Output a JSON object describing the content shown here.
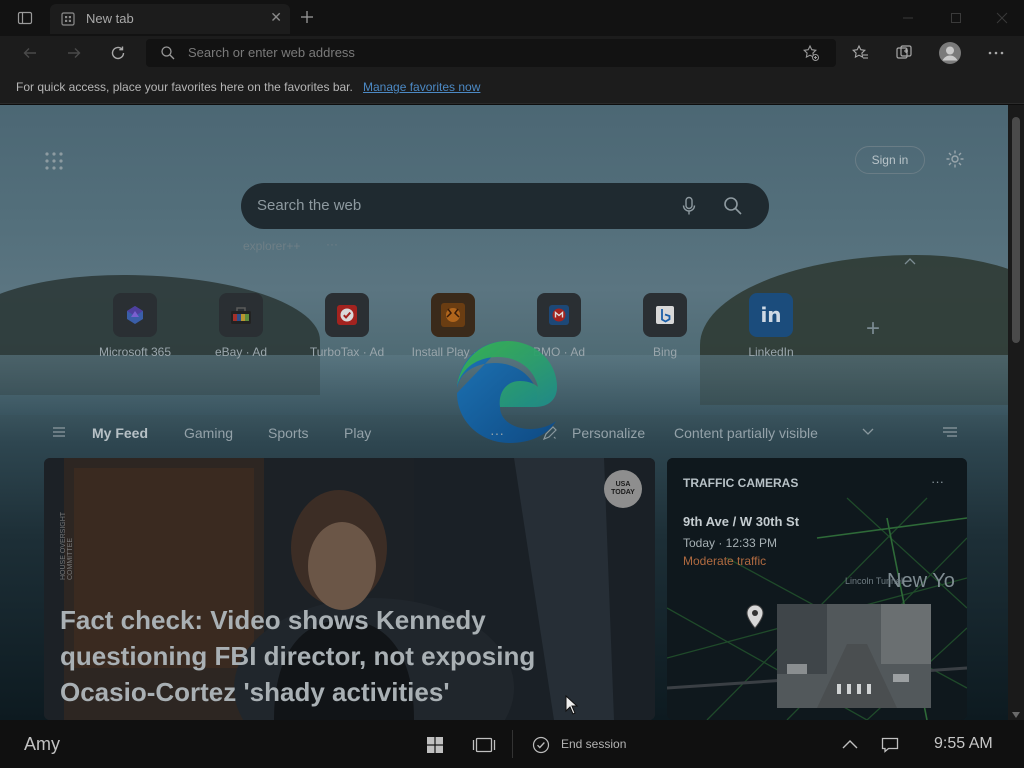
{
  "tabbar": {
    "tab_title": "New tab",
    "close_glyph": "✕",
    "new_tab_glyph": "+",
    "icons": [
      "tab-actions-icon",
      "newtab-page-icon",
      "close-icon",
      "plus-icon",
      "minimize-icon",
      "maximize-icon",
      "window-close-icon"
    ]
  },
  "toolbar": {
    "address_placeholder": "Search or enter web address",
    "icons": [
      "back-icon",
      "forward-icon",
      "refresh-icon",
      "search-icon",
      "add-favorite-icon",
      "favorites-icon",
      "collections-icon",
      "profile-icon",
      "more-icon"
    ]
  },
  "favbar": {
    "message": "For quick access, place your favorites here on the favorites bar.",
    "link": "Manage favorites now"
  },
  "newtab": {
    "search_placeholder": "Search the web",
    "suggestions": [
      "explorer++",
      "···"
    ],
    "signin_label": "Sign in",
    "tiles": [
      {
        "label": "Microsoft 365",
        "icon": "microsoft365-icon"
      },
      {
        "label": "eBay · Ad",
        "icon": "ebay-icon"
      },
      {
        "label": "TurboTax · Ad",
        "icon": "turbotax-icon"
      },
      {
        "label": "Install Play · Ad",
        "icon": "play-icon"
      },
      {
        "label": "BMO · Ad",
        "icon": "bmo-icon"
      },
      {
        "label": "Bing",
        "icon": "bing-icon"
      },
      {
        "label": "LinkedIn",
        "icon": "linkedin-icon"
      }
    ],
    "add_tile_glyph": "+",
    "feed_nav": {
      "items": [
        "My Feed",
        "Gaming",
        "Sports",
        "Play"
      ],
      "more": "···",
      "personalize": "Personalize",
      "content_visibility": "Content partially visible"
    },
    "main_card": {
      "badge": "USA TODAY",
      "side_caption": "HOUSE OVERSIGHT COMMITTEE",
      "headline": "Fact check: Video shows Kennedy questioning FBI director, not exposing Ocasio-Cortez 'shady activities'"
    },
    "side_card": {
      "title": "TRAFFIC CAMERAS",
      "more": "···",
      "location": "9th Ave / W 30th St",
      "time": "Today · 12:33 PM",
      "status": "Moderate traffic",
      "map_label": "New Yo",
      "map_small_label": "Lincoln Tunnel"
    }
  },
  "taskbar": {
    "user": "Amy",
    "end_session": "End session",
    "time": "9:55 AM",
    "icons": [
      "windows-start-icon",
      "task-view-icon",
      "check-circle-icon",
      "chevron-up-icon",
      "notification-icon"
    ]
  },
  "colors": {
    "accent_link": "#4c89c4",
    "traffic_status": "#c87a4a"
  }
}
